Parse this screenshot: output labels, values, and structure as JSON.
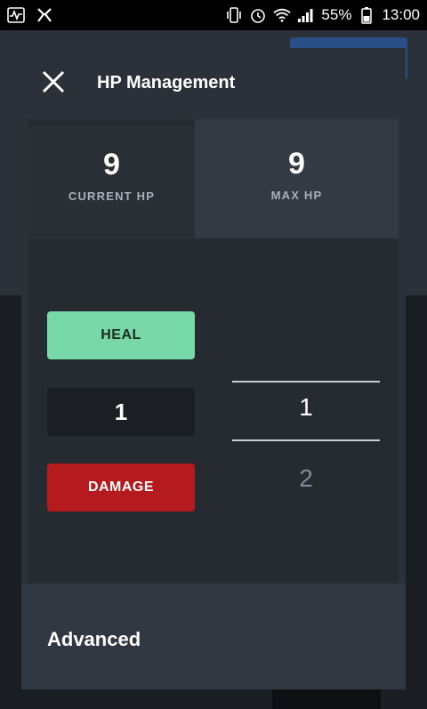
{
  "status_bar": {
    "battery_percent": "55%",
    "time": "13:00",
    "icons": [
      "activity-icon",
      "app-icon",
      "vibrate-icon",
      "alarm-icon",
      "wifi-icon",
      "signal-icon",
      "battery-icon"
    ]
  },
  "modal": {
    "title": "HP Management",
    "current_hp": {
      "value": "9",
      "label": "CURRENT HP"
    },
    "separator": "/",
    "max_hp": {
      "value": "9",
      "label": "MAX HP"
    },
    "heal_label": "HEAL",
    "amount_value": "1",
    "damage_label": "DAMAGE",
    "picker": {
      "selected": "1",
      "next": "2"
    },
    "advanced_label": "Advanced"
  },
  "colors": {
    "heal": "#79d8a8",
    "damage": "#b51b1e",
    "modal_bg": "#2c3139",
    "panel_bg": "#262a31"
  }
}
